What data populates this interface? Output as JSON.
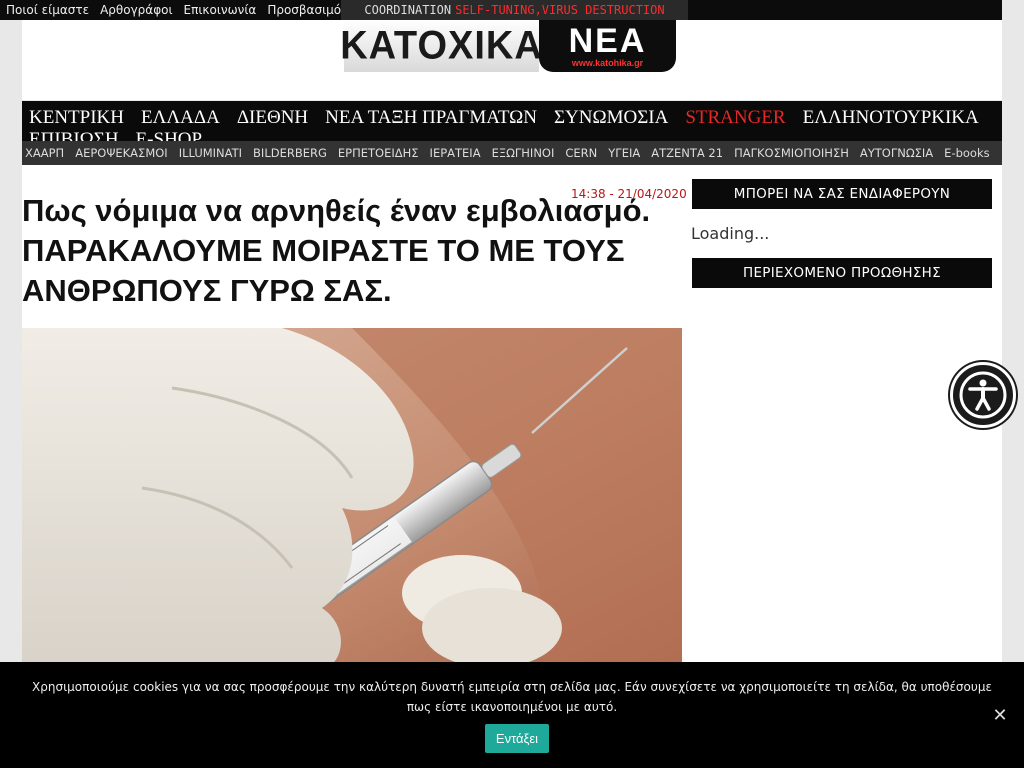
{
  "top_links": [
    "Ποιοί είμαστε",
    "Αρθογράφοι",
    "Επικοινωνία",
    "Προσβασιμότ"
  ],
  "top_banner": {
    "part1": "COORDINATION",
    "part2": "SELF-TUNING,VIRUS DESTRUCTION"
  },
  "logo": {
    "left_text": "ΚΑΤΟΧΙΚΑ",
    "right_text": "ΝΕΑ",
    "url": "www.katohika.gr"
  },
  "main_nav": {
    "row1": [
      "ΚΕΝΤΡΙΚΗ",
      "ΕΛΛΑΔΑ",
      "ΔΙΕΘΝΗ",
      "ΝΕΑ ΤΑΞΗ ΠΡΑΓΜΑΤΩΝ",
      "ΣΥΝΩΜΟΣΙΑ",
      "STRANGER",
      "ΕΛΛΗΝΟΤΟΥΡΚΙΚΑ"
    ],
    "row2": [
      "ΕΠΙΒΙΩΣΗ",
      "E-SHOP"
    ],
    "highlight_color": "#e82727"
  },
  "sub_nav": [
    "ΧΑΑΡΠ",
    "ΑΕΡΟΨΕΚΑΣΜΟΙ",
    "ILLUMINATI",
    "BILDERBERG",
    "ΕΡΠΕΤΟΕΙΔΗΣ",
    "ΙΕΡΑΤΕΙΑ",
    "ΕΞΩΓΗΙΝΟΙ",
    "CERN",
    "ΥΓΕΙΑ",
    "ΑΤΖΕΝΤΑ 21",
    "ΠΑΓΚΟΣΜΙΟΠΟΙΗΣΗ",
    "ΑΥΤΟΓΝΩΣΙΑ",
    "E-books"
  ],
  "article": {
    "date": "14:38 - 21/04/2020",
    "title": "Πως νόμιμα να αρνηθείς έναν εμβολιασμό. ΠΑΡΑΚΑΛΟΥΜΕ ΜΟΙΡΑΣΤΕ ΤΟ ΜΕ ΤΟΥΣ ΑΝΘΡΩΠΟΥΣ ΓΥΡΩ ΣΑΣ."
  },
  "sidebar": {
    "box1": "ΜΠΟΡΕΙ ΝΑ ΣΑΣ ΕΝΔΙΑΦΕΡΟΥΝ",
    "loading": "Loading...",
    "box2": "ΠΕΡΙΕΧΟΜΕΝΟ ΠΡΟΩΘΗΣΗΣ"
  },
  "accessibility_icon": "accessibility-person-icon",
  "cookie": {
    "text": "Χρησιμοποιούμε cookies για να σας προσφέρουμε την καλύτερη δυνατή εμπειρία στη σελίδα μας. Εάν συνεχίσετε να χρησιμοποιείτε τη σελίδα, θα υποθέσουμε πως είστε ικανοποιημένοι με αυτό.",
    "accept": "Εντάξει",
    "close": "✕",
    "accept_color": "#1ea99a"
  }
}
